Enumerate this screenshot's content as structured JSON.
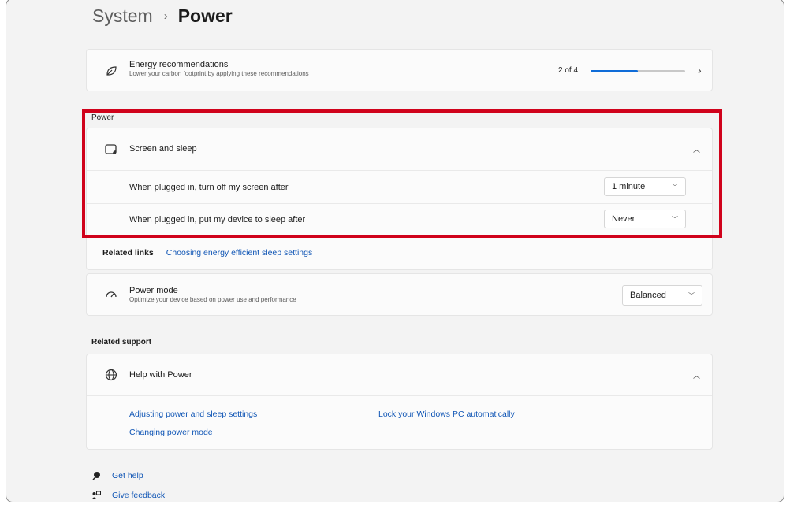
{
  "header": {
    "crumb": "System",
    "separator": "›",
    "current": "Power"
  },
  "energy_card": {
    "title": "Energy recommendations",
    "subtitle": "Lower your carbon footprint by applying these recommendations",
    "progress_text": "2 of 4",
    "progress_fraction": 0.5,
    "icon": "leaf-icon"
  },
  "power_section": {
    "label": "Power",
    "screen_sleep": {
      "title": "Screen and sleep",
      "icon": "screen-sleep-icon",
      "rows": [
        {
          "label": "When plugged in, turn off my screen after",
          "value": "1 minute"
        },
        {
          "label": "When plugged in, put my device to sleep after",
          "value": "Never"
        }
      ]
    },
    "related_links": {
      "label": "Related links",
      "link": "Choosing energy efficient sleep settings"
    },
    "power_mode": {
      "title": "Power mode",
      "subtitle": "Optimize your device based on power use and performance",
      "value": "Balanced",
      "icon": "power-mode-icon"
    }
  },
  "related_support": {
    "label": "Related support",
    "help": {
      "title": "Help with Power",
      "icon": "globe-icon",
      "links_col1": [
        "Adjusting power and sleep settings",
        "Changing power mode"
      ],
      "links_col2": [
        "Lock your Windows PC automatically"
      ]
    }
  },
  "footer": {
    "get_help": "Get help",
    "give_feedback": "Give feedback"
  },
  "colors": {
    "accent": "#0f6cd8",
    "link": "#0f55b5",
    "highlight": "#d0021b"
  }
}
